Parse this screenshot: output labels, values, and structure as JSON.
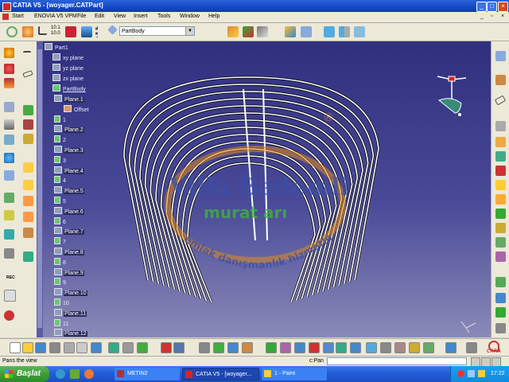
{
  "window": {
    "title": "CATIA V5 - [woyager.CATPart]",
    "controls": {
      "minimize": "_",
      "maximize": "□",
      "close": "×"
    }
  },
  "menu": {
    "items": [
      "Start",
      "ENOVIA V5 VPM",
      "File",
      "Edit",
      "View",
      "Insert",
      "Tools",
      "Window",
      "Help"
    ],
    "controls": {
      "minimize": "_",
      "restore": "▫",
      "close": "×"
    }
  },
  "toolbar": {
    "workbench_select": "PartBody",
    "fit_label_top": "10.1",
    "fit_label_bottom": "10.0"
  },
  "tree": {
    "root": "Part1",
    "planes": [
      "xy plane",
      "yz plane",
      "zx plane"
    ],
    "body": "PartBody",
    "items": [
      {
        "label": "Plane.1",
        "kind": "plane"
      },
      {
        "label": "Offset",
        "kind": "param"
      },
      {
        "label": "1",
        "kind": "sketch"
      },
      {
        "label": "Plane.2",
        "kind": "plane"
      },
      {
        "label": "2",
        "kind": "sketch"
      },
      {
        "label": "Plane.3",
        "kind": "plane"
      },
      {
        "label": "3",
        "kind": "sketch"
      },
      {
        "label": "Plane.4",
        "kind": "plane"
      },
      {
        "label": "4",
        "kind": "sketch"
      },
      {
        "label": "Plane.5",
        "kind": "plane"
      },
      {
        "label": "5",
        "kind": "sketch"
      },
      {
        "label": "Plane.6",
        "kind": "plane"
      },
      {
        "label": "6",
        "kind": "sketch"
      },
      {
        "label": "Plane.7",
        "kind": "plane"
      },
      {
        "label": "7",
        "kind": "sketch"
      },
      {
        "label": "Plane.8",
        "kind": "plane"
      },
      {
        "label": "8",
        "kind": "sketch"
      },
      {
        "label": "Plane.9",
        "kind": "plane"
      },
      {
        "label": "9",
        "kind": "sketch"
      },
      {
        "label": "Plane.10",
        "kind": "plane"
      },
      {
        "label": "10",
        "kind": "sketch"
      },
      {
        "label": "Plane.11",
        "kind": "plane"
      },
      {
        "label": "11",
        "kind": "sketch"
      },
      {
        "label": "Plane.12",
        "kind": "plane"
      }
    ]
  },
  "left_toolbar": {
    "label_rec": "REC"
  },
  "watermark": {
    "line1": "Villa Bademli",
    "line2": "murat arı",
    "arc": "emlak danışmanlık hizmetleri",
    "symbol": "®"
  },
  "status": {
    "message": "Pans the view",
    "prompt": "c:Pan"
  },
  "taskbar": {
    "start": "Başlat",
    "tasks": [
      "METIN2",
      "CATIA V5 - [woyager...",
      "1 - Paint"
    ],
    "clock": "17:22"
  },
  "catia_logo": "CATIA",
  "colors": {
    "titlebar": "#1448c8",
    "viewport_top": "#2f2f7e",
    "viewport_bottom": "#8a8ab8",
    "model_fill": "#ffffff",
    "model_edge": "#000000",
    "watermark_orange": "#e08a1e",
    "watermark_green": "#3cb43c",
    "watermark_blue": "#3a4fa8",
    "start_green": "#3d9d38"
  }
}
